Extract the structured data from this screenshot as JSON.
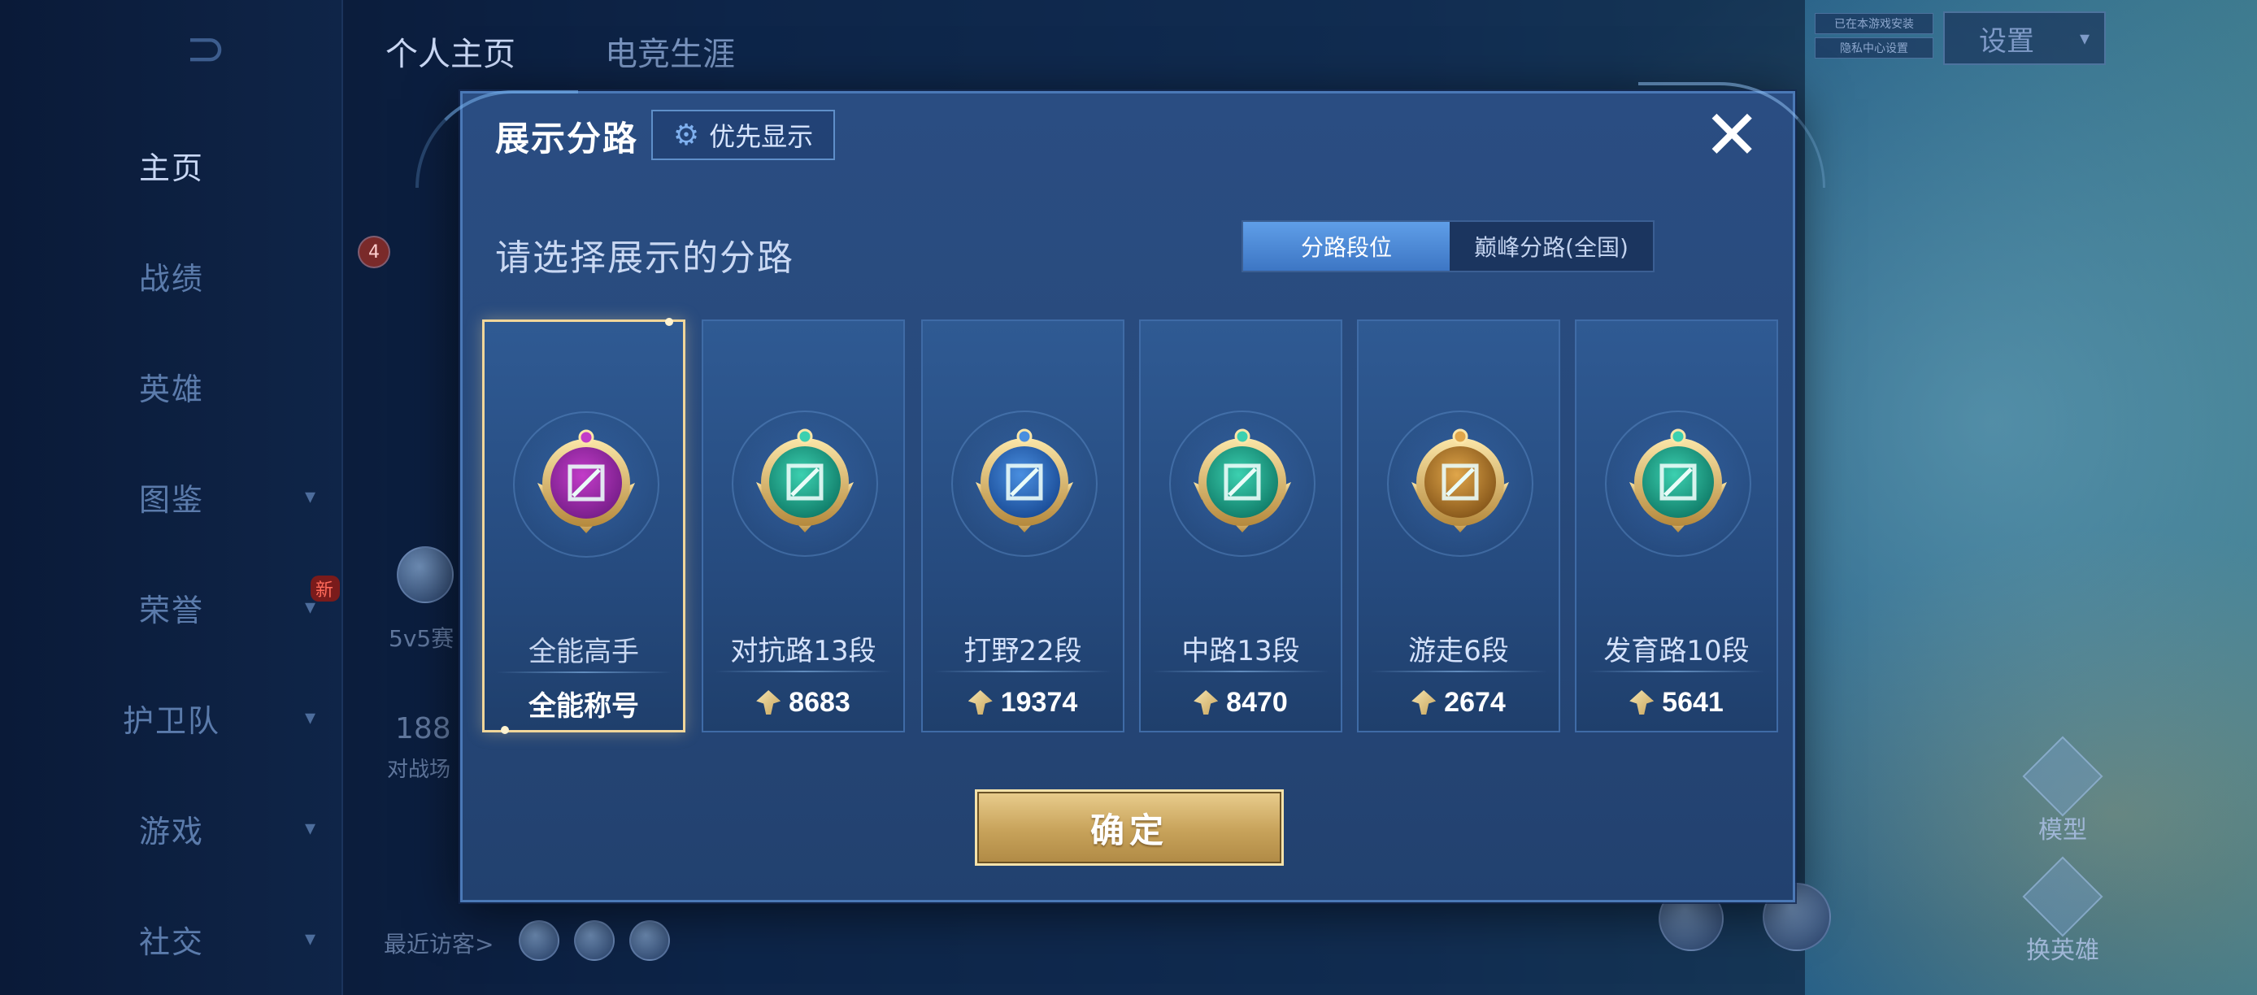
{
  "nav": {
    "back_label": "⊃",
    "items": [
      {
        "label": "主页",
        "has_chevron": false,
        "active": true
      },
      {
        "label": "战绩",
        "has_chevron": false,
        "active": false
      },
      {
        "label": "英雄",
        "has_chevron": false,
        "active": false
      },
      {
        "label": "图鉴",
        "has_chevron": true,
        "active": false
      },
      {
        "label": "荣誉",
        "has_chevron": true,
        "active": false,
        "badge": "新"
      },
      {
        "label": "护卫队",
        "has_chevron": true,
        "active": false
      },
      {
        "label": "游戏",
        "has_chevron": true,
        "active": false
      },
      {
        "label": "社交",
        "has_chevron": true,
        "active": false
      }
    ]
  },
  "top_tabs": [
    "个人主页",
    "电竞生涯"
  ],
  "settings": {
    "label": "设置",
    "dropdown_glyph": "▾"
  },
  "status_chips": [
    "已在本游戏安装",
    "隐私中心设置"
  ],
  "background": {
    "mode_label": "5v5赛",
    "count_text": "188",
    "sub_text": "对战场",
    "visitors_label": "最近访客>",
    "badge_count": "4",
    "right_tools": [
      "模型",
      "换英雄"
    ]
  },
  "dialog": {
    "title": "展示分路",
    "priority_button": "优先显示",
    "gear_glyph": "⚙",
    "close_glyph": "✕",
    "prompt": "请选择展示的分路",
    "segment": {
      "options": [
        "分路段位",
        "巅峰分路(全国)"
      ],
      "selected": 0
    },
    "cards": [
      {
        "name": "全能高手",
        "value": "全能称号",
        "selected": true,
        "emblem": "all-round-emblem-icon",
        "gem": "#c23cc8",
        "gem_dark": "#7a1f8c"
      },
      {
        "name": "对抗路13段",
        "value": "8683",
        "selected": false,
        "emblem": "clash-lane-emblem-icon",
        "gem": "#3cd0b0",
        "gem_dark": "#12806c"
      },
      {
        "name": "打野22段",
        "value": "19374",
        "selected": false,
        "emblem": "jungle-emblem-icon",
        "gem": "#4a8fe0",
        "gem_dark": "#1c4f9a"
      },
      {
        "name": "中路13段",
        "value": "8470",
        "selected": false,
        "emblem": "mid-lane-emblem-icon",
        "gem": "#3cd0b0",
        "gem_dark": "#12806c"
      },
      {
        "name": "游走6段",
        "value": "2674",
        "selected": false,
        "emblem": "roam-emblem-icon",
        "gem": "#e0a64a",
        "gem_dark": "#8a5a1c"
      },
      {
        "name": "发育路10段",
        "value": "5641",
        "selected": false,
        "emblem": "farm-lane-emblem-icon",
        "gem": "#3cd0b0",
        "gem_dark": "#12806c"
      }
    ],
    "confirm_label": "确定"
  },
  "colors": {
    "accent_gold": "#e9cd8d",
    "segment_active": "#4f8ad6",
    "selected_border": "#f0d69a"
  }
}
